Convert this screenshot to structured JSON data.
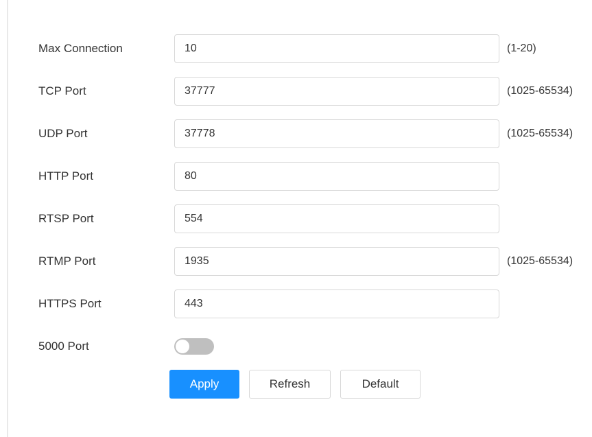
{
  "form": {
    "max_connection": {
      "label": "Max Connection",
      "value": "10",
      "hint": "(1-20)"
    },
    "tcp_port": {
      "label": "TCP Port",
      "value": "37777",
      "hint": "(1025-65534)"
    },
    "udp_port": {
      "label": "UDP Port",
      "value": "37778",
      "hint": "(1025-65534)"
    },
    "http_port": {
      "label": "HTTP Port",
      "value": "80"
    },
    "rtsp_port": {
      "label": "RTSP Port",
      "value": "554"
    },
    "rtmp_port": {
      "label": "RTMP Port",
      "value": "1935",
      "hint": "(1025-65534)"
    },
    "https_port": {
      "label": "HTTPS Port",
      "value": "443"
    },
    "port_5000": {
      "label": "5000 Port",
      "enabled": false
    }
  },
  "buttons": {
    "apply": "Apply",
    "refresh": "Refresh",
    "default": "Default"
  },
  "colors": {
    "accent": "#1890ff",
    "toggle_off": "#bfbfbf",
    "border": "#d7d7d7"
  }
}
